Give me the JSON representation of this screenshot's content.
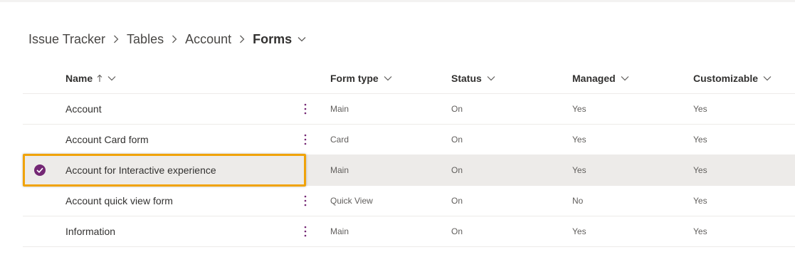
{
  "breadcrumb": {
    "items": [
      "Issue Tracker",
      "Tables",
      "Account"
    ],
    "current": "Forms"
  },
  "columns": {
    "name": "Name",
    "form_type": "Form type",
    "status": "Status",
    "managed": "Managed",
    "customizable": "Customizable"
  },
  "sort": {
    "column": "name",
    "direction": "ascending",
    "icon": "arrow-up-icon"
  },
  "rows": [
    {
      "name": "Account",
      "form_type": "Main",
      "status": "On",
      "managed": "Yes",
      "customizable": "Yes",
      "selected": false
    },
    {
      "name": "Account Card form",
      "form_type": "Card",
      "status": "On",
      "managed": "Yes",
      "customizable": "Yes",
      "selected": false
    },
    {
      "name": "Account for Interactive experience",
      "form_type": "Main",
      "status": "On",
      "managed": "Yes",
      "customizable": "Yes",
      "selected": true
    },
    {
      "name": "Account quick view form",
      "form_type": "Quick View",
      "status": "On",
      "managed": "No",
      "customizable": "Yes",
      "selected": false
    },
    {
      "name": "Information",
      "form_type": "Main",
      "status": "On",
      "managed": "Yes",
      "customizable": "Yes",
      "selected": false
    }
  ],
  "colors": {
    "accent": "#742774",
    "highlight": "#f0a30a",
    "selected_row": "#edebe9"
  }
}
